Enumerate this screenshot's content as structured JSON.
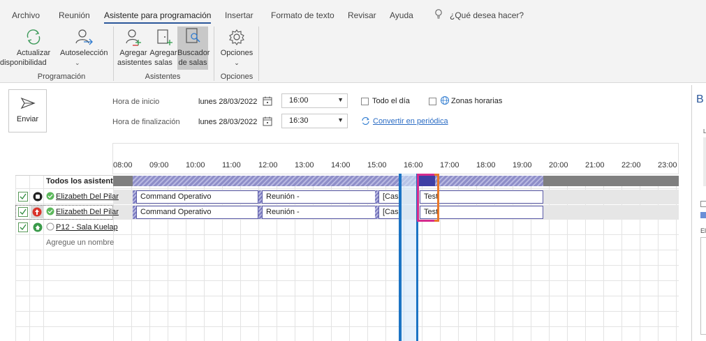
{
  "tabs": [
    "Archivo",
    "Reunión",
    "Asistente para programación",
    "Insertar",
    "Formato de texto",
    "Revisar",
    "Ayuda"
  ],
  "tell_me": "¿Qué desea hacer?",
  "ribbon": {
    "refresh": "Actualizar",
    "refresh_2": "disponibilidad",
    "autoselect": "Autoselección",
    "add_attendees": "Agregar",
    "add_attendees_2": "asistentes",
    "add_rooms": "Agregar",
    "add_rooms_2": "salas",
    "room_finder": "Buscador",
    "room_finder_2": "de salas",
    "options": "Opciones",
    "group_scheduling": "Programación",
    "group_attendees": "Asistentes",
    "group_options": "Opciones"
  },
  "form": {
    "send": "Enviar",
    "start_label": "Hora de inicio",
    "end_label": "Hora de finalización",
    "start_date": "lunes 28/03/2022",
    "end_date": "lunes 28/03/2022",
    "start_time": "16:00",
    "end_time": "16:30",
    "all_day": "Todo el día",
    "time_zones": "Zonas horarias",
    "recurring": "Convertir en periódica"
  },
  "timeline": {
    "hours": [
      "08:00",
      "09:00",
      "10:00",
      "11:00",
      "12:00",
      "13:00",
      "14:00",
      "15:00",
      "16:00",
      "17:00",
      "18:00",
      "19:00",
      "20:00",
      "21:00",
      "22:00",
      "23:00"
    ]
  },
  "attendees": {
    "all": "Todos los asistent...",
    "add_name": "Agregue un nombre",
    "rows": [
      {
        "name": "Elizabeth Del Pilar"
      },
      {
        "name": "Elizabeth Del Pilar"
      },
      {
        "name": "P12 - Sala Kuelap"
      }
    ]
  },
  "appointments": {
    "command": "Command Operativo",
    "meeting": "Reunión -",
    "cas": "[Cas",
    "test": "Test"
  },
  "right_panel": {
    "initial": "B",
    "small_a": "L",
    "small_b": "El"
  },
  "colors": {
    "accent": "#2b579a",
    "busy_hatch": "#8e8ec8",
    "selection_blue": "#1c74c4",
    "highlight_magenta": "#d62c8e",
    "highlight_orange": "#e9782a"
  }
}
